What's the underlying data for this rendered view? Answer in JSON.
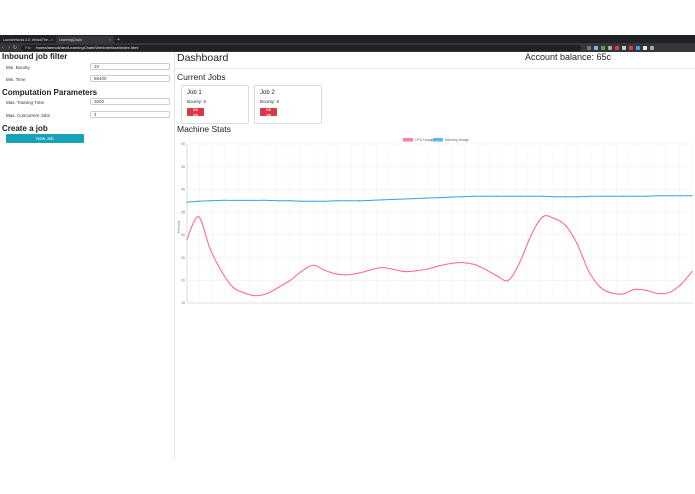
{
  "browser": {
    "tabs": [
      {
        "label": "LaunchHacks 4.0: #HackThe...",
        "active": false
      },
      {
        "label": "LearningChain",
        "active": true
      }
    ],
    "url_scheme": "File",
    "url": "/home/aemoli/dev/LearningChain/WebInterface/index.html"
  },
  "sidebar": {
    "inbound_title": "Inbound job filter",
    "min_bounty_label": "Min. Bounty",
    "min_bounty_value": "10",
    "min_time_label": "Min. Time",
    "min_time_value": "86400",
    "computation_title": "Computation Parameters",
    "max_training_label": "Max. Training Time",
    "max_training_value": "3600",
    "max_concurrent_label": "Max. Concurrent Jobs",
    "max_concurrent_value": "4",
    "create_title": "Create a job",
    "new_job_label": "New Job"
  },
  "main": {
    "title": "Dashboard",
    "balance": "Account balance: 65c",
    "current_jobs_title": "Current Jobs",
    "jobs": [
      {
        "title": "Job 1",
        "bounty": "Bounty: 5",
        "kill_label": "Kill job"
      },
      {
        "title": "Job 2",
        "bounty": "Bounty: 5",
        "kill_label": "Kill job"
      }
    ],
    "machine_stats_title": "Machine Stats"
  },
  "colors": {
    "cpu": "#ff6384",
    "memory": "#36a2eb",
    "new_job": "#17a2b8",
    "kill": "#dc3545"
  },
  "chart_data": {
    "type": "line",
    "ylabel": "Percent",
    "ylim": [
      15,
      50
    ],
    "yticks": [
      15,
      20,
      25,
      30,
      35,
      40,
      45,
      50
    ],
    "grid": true,
    "legend_position": "top",
    "x_count": 40,
    "series": [
      {
        "name": "CPU Usage",
        "values": [
          29,
          34,
          27,
          22,
          18.5,
          17.2,
          16.6,
          17.1,
          18.5,
          20,
          22,
          23.3,
          22.2,
          21.4,
          21.2,
          21.6,
          22.3,
          22.8,
          22.4,
          21.9,
          22.1,
          22.5,
          23.2,
          23.7,
          23.9,
          23.5,
          22.4,
          21,
          20,
          24,
          30,
          34,
          33.6,
          32,
          28,
          22,
          18.5,
          17.2,
          17,
          18,
          17.8,
          17.1,
          17.3,
          19,
          21.9
        ]
      },
      {
        "name": "Memory Usage",
        "values": [
          37.2,
          37.4,
          37.5,
          37.6,
          37.6,
          37.6,
          37.6,
          37.6,
          37.5,
          37.5,
          37.4,
          37.4,
          37.4,
          37.5,
          37.5,
          37.5,
          37.6,
          37.7,
          37.8,
          37.9,
          38,
          38.1,
          38.2,
          38.3,
          38.4,
          38.5,
          38.5,
          38.5,
          38.5,
          38.5,
          38.5,
          38.5,
          38.4,
          38.4,
          38.4,
          38.5,
          38.5,
          38.5,
          38.5,
          38.5,
          38.5,
          38.6,
          38.6,
          38.6,
          38.6
        ]
      }
    ]
  }
}
